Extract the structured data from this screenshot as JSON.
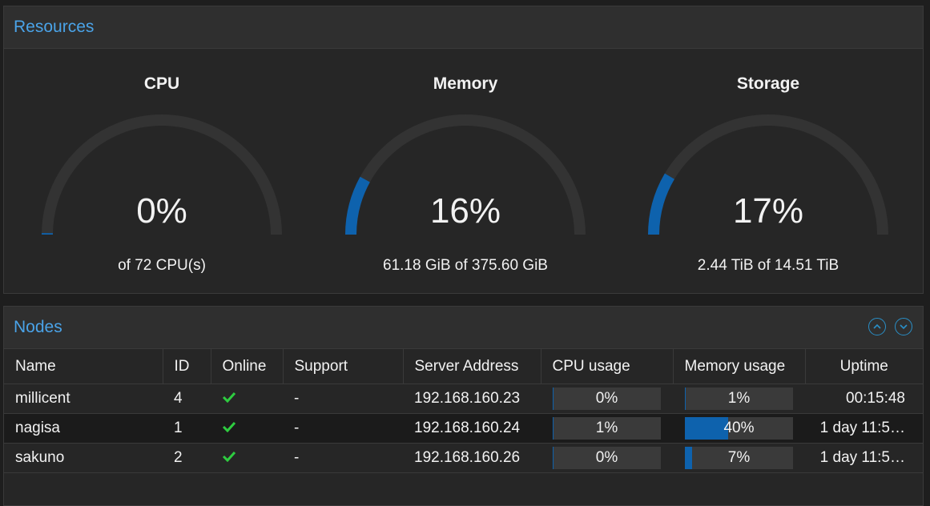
{
  "resources": {
    "title": "Resources",
    "gauges": [
      {
        "title": "CPU",
        "value": "0%",
        "fraction": 0.004,
        "text": "of 72 CPU(s)"
      },
      {
        "title": "Memory",
        "value": "16%",
        "fraction": 0.16,
        "text": "61.18 GiB of 375.60 GiB"
      },
      {
        "title": "Storage",
        "value": "17%",
        "fraction": 0.17,
        "text": "2.44 TiB of 14.51 TiB"
      }
    ]
  },
  "nodes": {
    "title": "Nodes",
    "icons": {
      "collapse": "chevron-up-icon",
      "expand": "chevron-down-icon"
    },
    "columns": [
      "Name",
      "ID",
      "Online",
      "Support",
      "Server Address",
      "CPU usage",
      "Memory usage",
      "Uptime"
    ],
    "rows": [
      {
        "name": "millicent",
        "id": "4",
        "online": true,
        "support": "-",
        "address": "192.168.160.23",
        "cpu": "0%",
        "cpu_fraction": 0.0,
        "mem": "1%",
        "mem_fraction": 0.01,
        "uptime": "00:15:48"
      },
      {
        "name": "nagisa",
        "id": "1",
        "online": true,
        "support": "-",
        "address": "192.168.160.24",
        "cpu": "1%",
        "cpu_fraction": 0.01,
        "mem": "40%",
        "mem_fraction": 0.4,
        "uptime": "1 day 11:5…"
      },
      {
        "name": "sakuno",
        "id": "2",
        "online": true,
        "support": "-",
        "address": "192.168.160.26",
        "cpu": "0%",
        "cpu_fraction": 0.0,
        "mem": "7%",
        "mem_fraction": 0.07,
        "uptime": "1 day 11:5…"
      }
    ]
  },
  "colors": {
    "accent": "#4aa3e8",
    "bar": "#0e62ad",
    "online": "#2ecc40",
    "track": "#333333"
  }
}
